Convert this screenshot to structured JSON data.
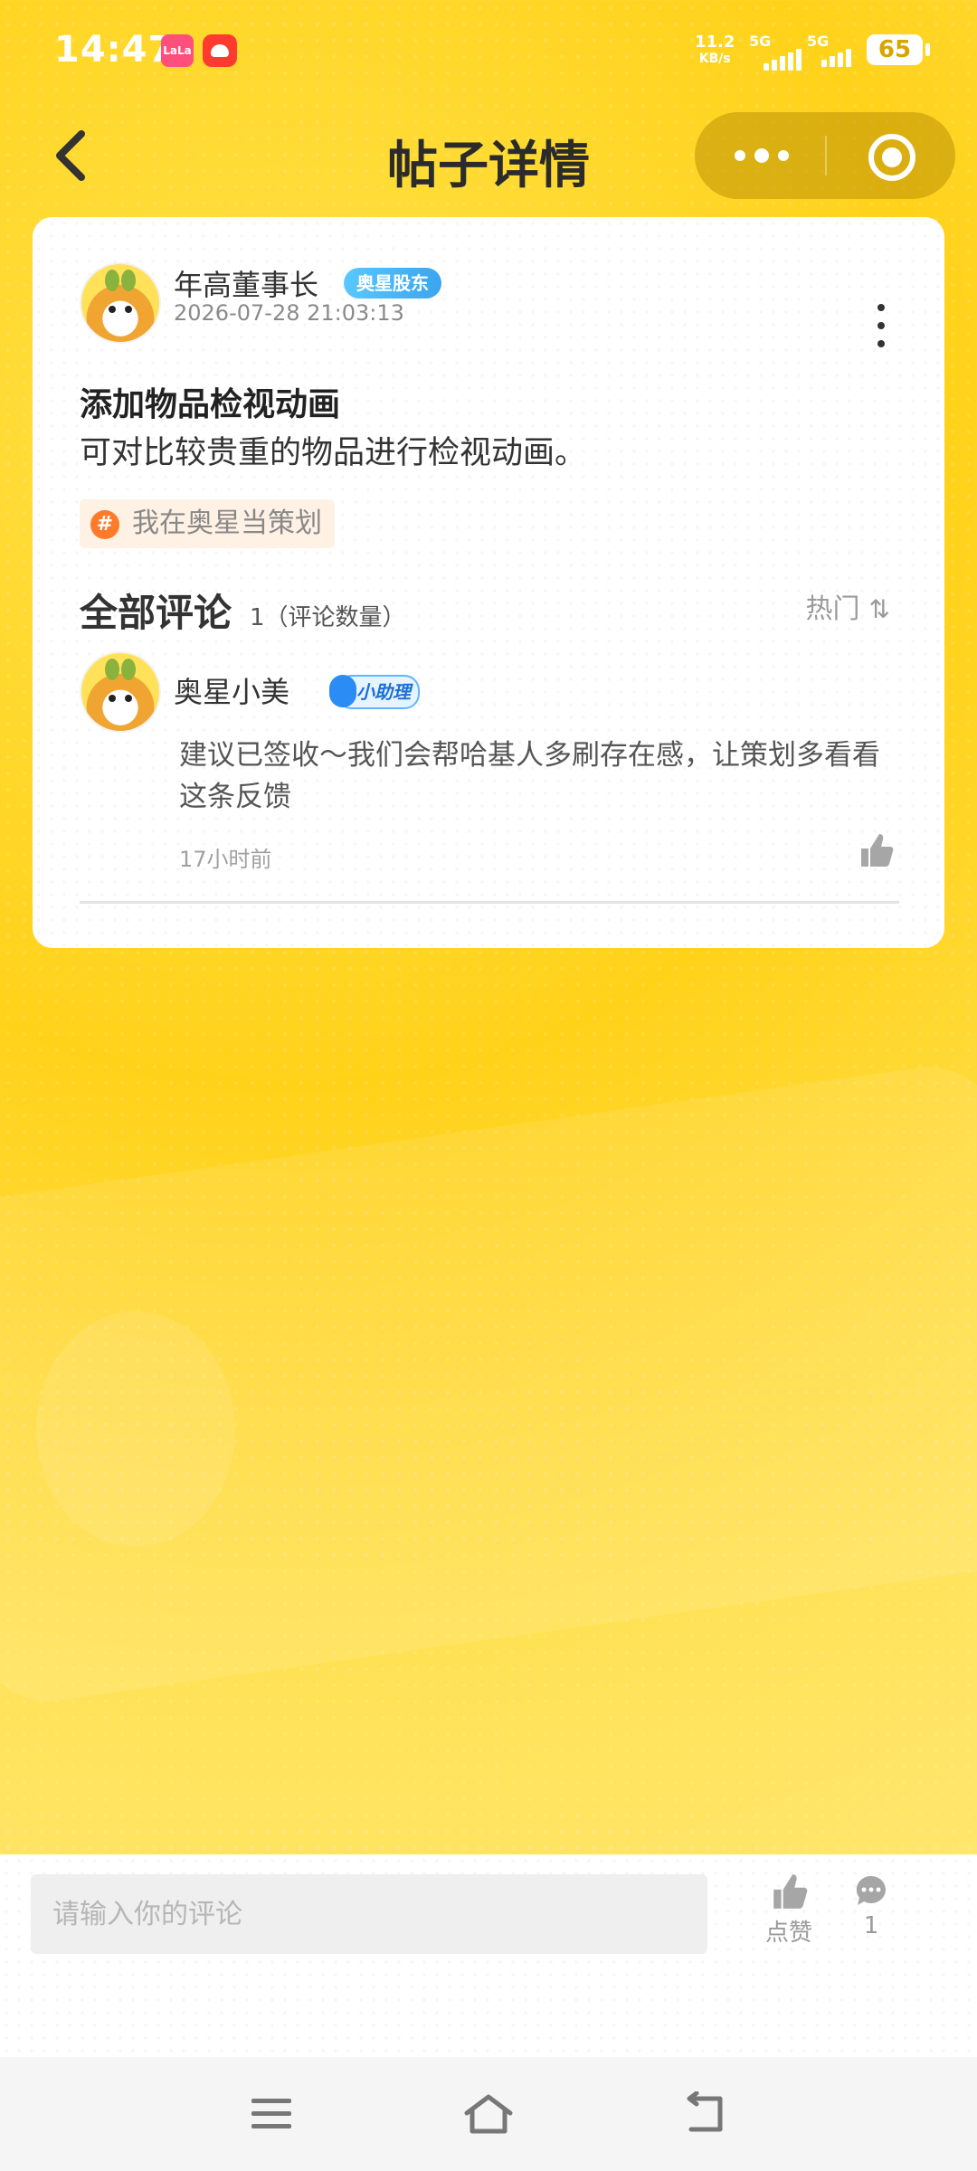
{
  "status_bar": {
    "time": "14:47",
    "app_icon_1_text": "LaLa",
    "net_speed_value": "11.2",
    "net_speed_unit": "KB/s",
    "sim1_label": "5G",
    "sim2_label": "5G",
    "battery": "65"
  },
  "nav": {
    "title": "帖子详情",
    "back_icon": "chevron-left-icon",
    "more_icon": "more-dots-icon",
    "close_icon": "target-close-icon"
  },
  "post": {
    "author": {
      "name": "年高董事长",
      "badge": "奥星股东"
    },
    "date": "2026-07-28 21:03:13",
    "title": "添加物品检视动画",
    "body": "可对比较贵重的物品进行检视动画。",
    "tag": {
      "symbol": "#",
      "label": "我在奥星当策划"
    }
  },
  "comments": {
    "heading": "全部评论",
    "count_text": "1（评论数量）",
    "sort_label": "热门",
    "sort_icon": "sort-arrows-icon",
    "items": [
      {
        "name": "奥星小美",
        "badge": "小助理",
        "text": "建议已签收～我们会帮哈基人多刷存在感，让策划多看看这条反馈",
        "time": "17小时前"
      }
    ]
  },
  "bottom_bar": {
    "input_placeholder": "请输入你的评论",
    "like_label": "点赞",
    "comment_count": "1"
  },
  "colors": {
    "background": "#ffd21a",
    "holder_badge": "#3ba5ef",
    "assist_badge": "#2b8cf6",
    "tag_hash": "#ff7a2a"
  }
}
